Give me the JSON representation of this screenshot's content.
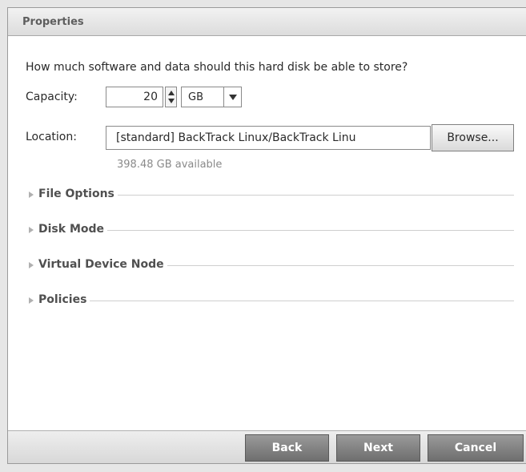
{
  "header": {
    "title": "Properties"
  },
  "question": "How much software and data should this hard disk be able to store?",
  "capacity": {
    "label": "Capacity:",
    "value": "20",
    "unit": "GB"
  },
  "location": {
    "label": "Location:",
    "value": "[standard] BackTrack Linux/BackTrack Linu",
    "browse_label": "Browse...",
    "available": "398.48 GB available"
  },
  "sections": [
    {
      "label": "File Options"
    },
    {
      "label": "Disk Mode"
    },
    {
      "label": "Virtual Device Node"
    },
    {
      "label": "Policies"
    }
  ],
  "footer": {
    "back_label": "Back",
    "next_label": "Next",
    "cancel_label": "Cancel"
  }
}
